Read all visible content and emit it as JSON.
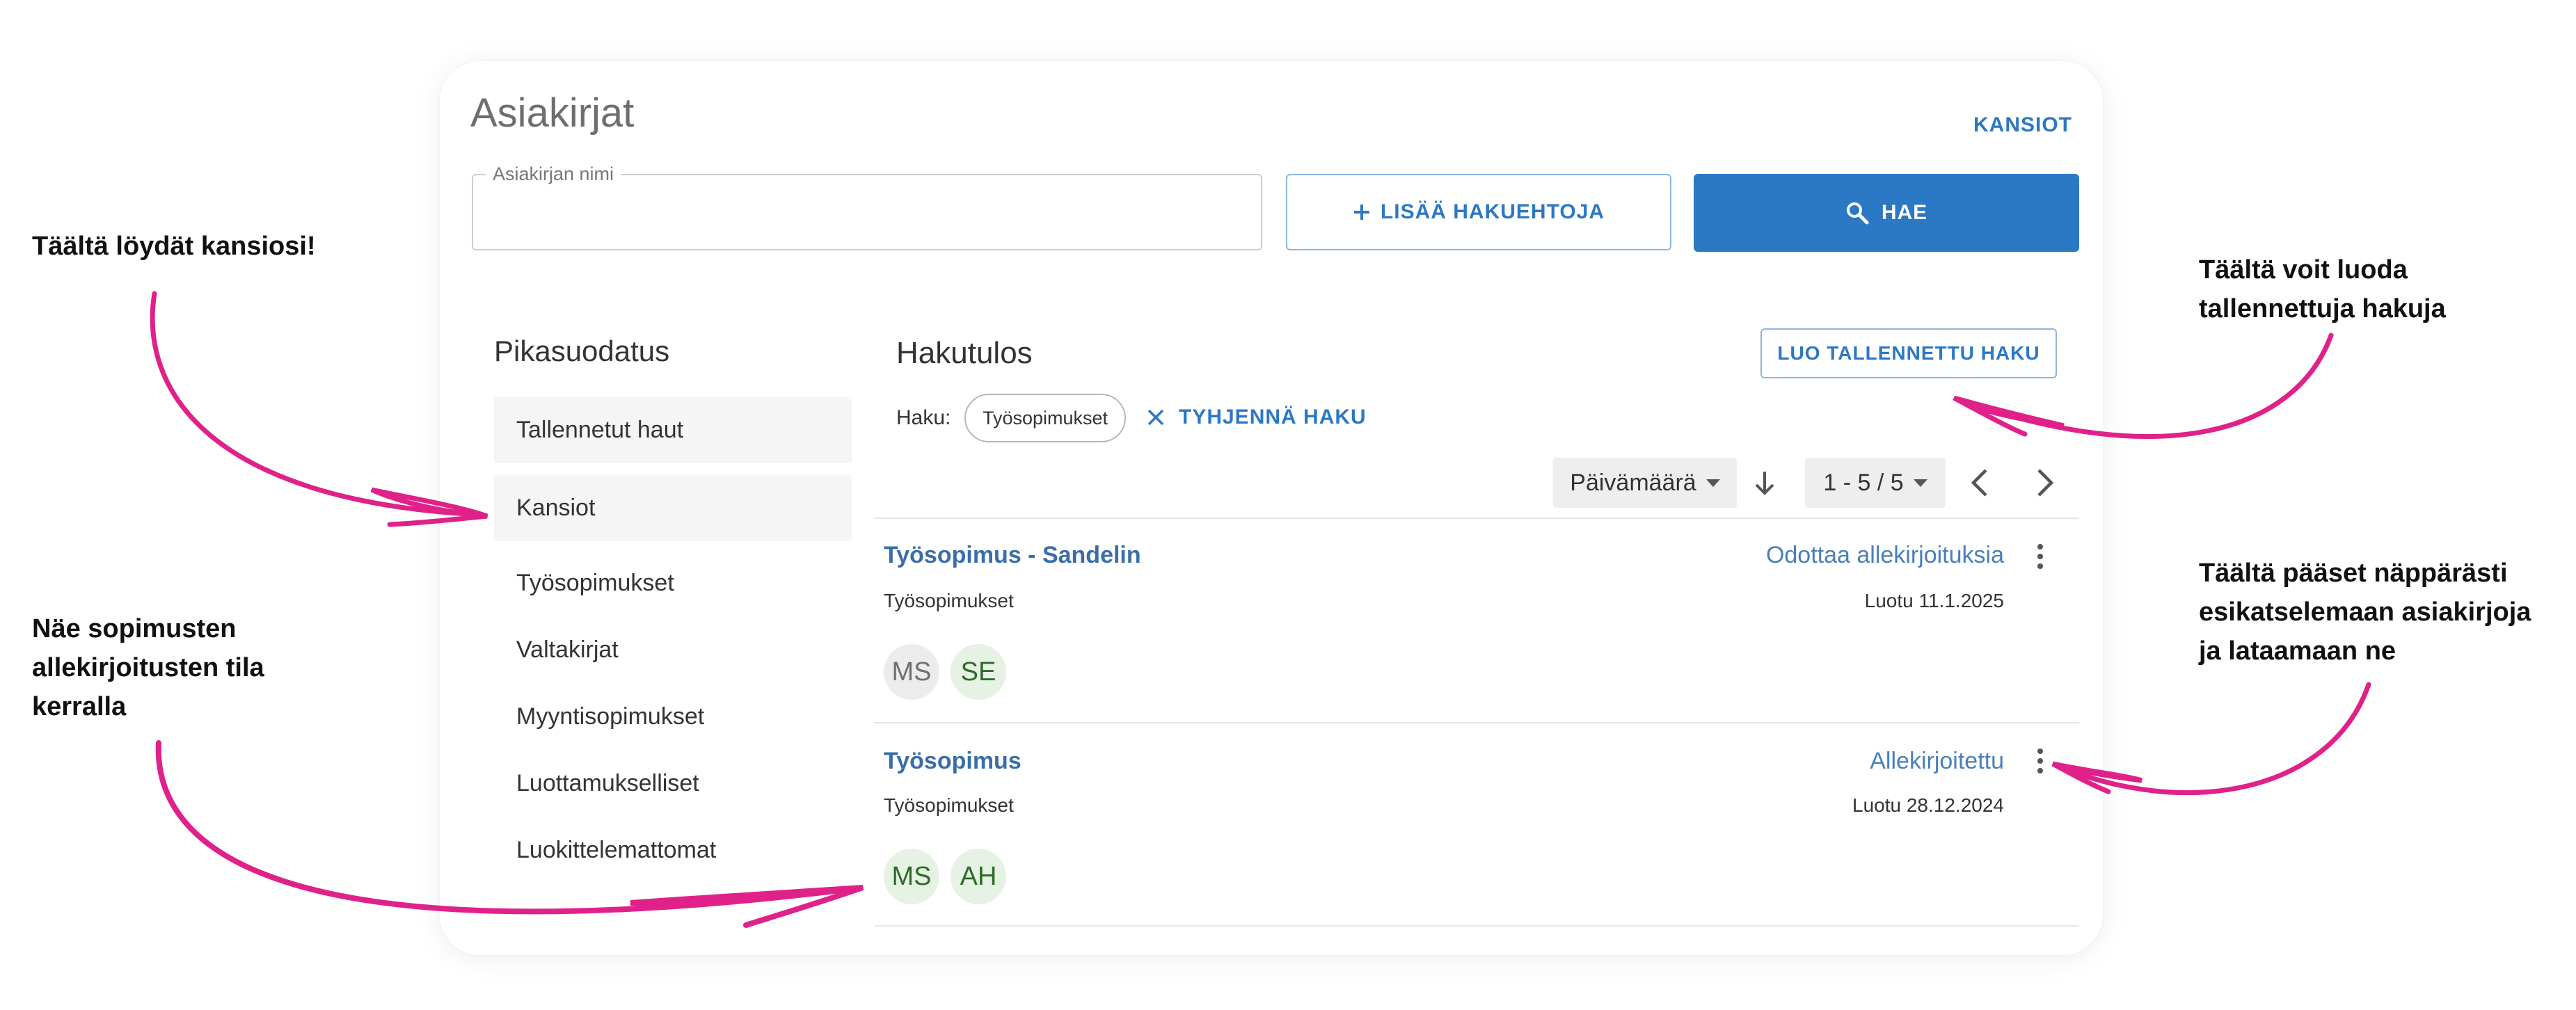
{
  "page": {
    "title": "Asiakirjat",
    "folders_link": "KANSIOT"
  },
  "search": {
    "field_label": "Asiakirjan nimi",
    "field_value": "",
    "add_criteria_label": "LISÄÄ HAKUEHTOJA",
    "search_label": "HAE"
  },
  "quick_filter": {
    "title": "Pikasuodatus",
    "items": [
      {
        "label": "Tallennetut haut"
      },
      {
        "label": "Kansiot"
      },
      {
        "label": "Työsopimukset"
      },
      {
        "label": "Valtakirjat"
      },
      {
        "label": "Myyntisopimukset"
      },
      {
        "label": "Luottamukselliset"
      },
      {
        "label": "Luokittelemattomat"
      }
    ]
  },
  "results": {
    "title": "Hakutulos",
    "save_search_label": "LUO TALLENNETTU HAKU",
    "haku_label": "Haku:",
    "active_filter": "Työsopimukset",
    "clear_label": "TYHJENNÄ HAKU",
    "sort_label": "Päivämäärä",
    "pager_label": "1 - 5 / 5",
    "documents": [
      {
        "title": "Työsopimus - Sandelin",
        "status": "Odottaa allekirjoituksia",
        "category": "Työsopimukset",
        "created": "Luotu 11.1.2025",
        "signers": [
          "MS",
          "SE"
        ]
      },
      {
        "title": "Työsopimus",
        "status": "Allekirjoitettu",
        "category": "Työsopimukset",
        "created": "Luotu 28.12.2024",
        "signers": [
          "MS",
          "AH"
        ]
      }
    ]
  },
  "annotations": {
    "folders_line1": "Täältä löydät kansiosi!",
    "saved_line1": "Täältä voit luoda",
    "saved_line2": "tallennettuja hakuja",
    "status_line1": "Näe sopimusten",
    "status_line2": "allekirjoitusten tila",
    "status_line3": "kerralla",
    "preview_line1": "Täältä pääset näppärästi",
    "preview_line2": "esikatselemaan asiakirjoja",
    "preview_line3": "ja lataamaan ne"
  },
  "colors": {
    "accent": "#2b78c5",
    "annotation_arrow": "#e0218a"
  }
}
